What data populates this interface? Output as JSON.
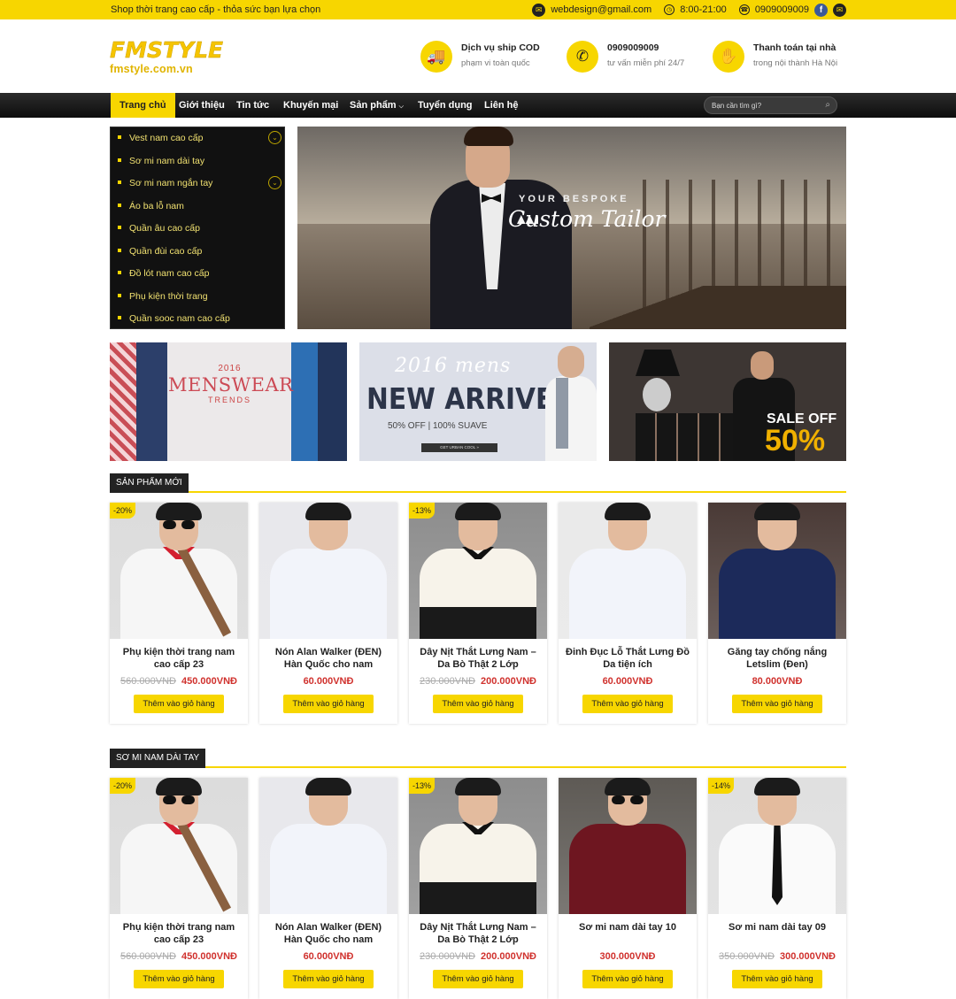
{
  "topbar": {
    "slogan": "Shop thời trang cao cấp - thỏa sức bạn lựa chọn",
    "email": "webdesign@gmail.com",
    "hours": "8:00-21:00",
    "phone": "0909009009"
  },
  "logo": {
    "main": "FMSTYLE",
    "sub": "fmstyle.com.vn"
  },
  "services": [
    {
      "title": "Dịch vụ ship COD",
      "sub": "phạm vi toàn quốc",
      "icon": "truck-icon"
    },
    {
      "title": "0909009009",
      "sub": "tư vấn miễn phí 24/7",
      "icon": "phone-icon"
    },
    {
      "title": "Thanh toán tại nhà",
      "sub": "trong nội thành Hà Nội",
      "icon": "payment-hand-icon"
    }
  ],
  "nav": {
    "items": [
      "Trang chủ",
      "Giới thiệu",
      "Tin tức",
      "Khuyến mại",
      "Sản phẩm",
      "Tuyển dụng",
      "Liên hệ"
    ],
    "active": "Trang chủ",
    "search_placeholder": "Bạn cần tìm gì?"
  },
  "categories": [
    "Vest nam cao cấp",
    "Sơ mi nam dài tay",
    "Sơ mi nam ngắn tay",
    "Áo ba lỗ nam",
    "Quần âu cao cấp",
    "Quần đùi cao cấp",
    "Đồ lót nam cao cấp",
    "Phụ kiện thời trang",
    "Quần sooc nam cao cấp"
  ],
  "hero": {
    "line1": "YOUR BESPOKE",
    "line2": "Custom Tailor"
  },
  "banners": {
    "b1": {
      "year": "2016",
      "main": "MENSWEAR",
      "sub": "TRENDS"
    },
    "b2": {
      "year": "2016 mens",
      "main": "NEW ARRIVE",
      "offer": "50% OFF | 100% SUAVE",
      "button": "GET URBAN COOL »"
    },
    "b3": {
      "sale": "SALE OFF",
      "pct": "50%"
    }
  },
  "sections": [
    {
      "title": "SẢN PHẨM MỚI",
      "products": [
        {
          "name": "Phụ kiện thời trang nam cao cấp 23",
          "old_price": "560.000VNĐ",
          "price": "450.000VNĐ",
          "badge": "-20%",
          "button": "Thêm vào giỏ hàng"
        },
        {
          "name": "Nón Alan Walker (ĐEN) Hàn Quốc cho nam",
          "old_price": "",
          "price": "60.000VNĐ",
          "badge": "",
          "button": "Thêm vào giỏ hàng"
        },
        {
          "name": "Dây Nịt Thắt Lưng Nam – Da Bò Thật 2 Lớp",
          "old_price": "230.000VNĐ",
          "price": "200.000VNĐ",
          "badge": "-13%",
          "button": "Thêm vào giỏ hàng"
        },
        {
          "name": "Đinh Đục Lỗ Thắt Lưng Đồ Da tiện ích",
          "old_price": "",
          "price": "60.000VNĐ",
          "badge": "",
          "button": "Thêm vào giỏ hàng"
        },
        {
          "name": "Găng tay chống nắng Letslim (Đen)",
          "old_price": "",
          "price": "80.000VNĐ",
          "badge": "",
          "button": "Thêm vào giỏ hàng"
        }
      ]
    },
    {
      "title": "SƠ MI NAM DÀI TAY",
      "products": [
        {
          "name": "Phụ kiện thời trang nam cao cấp 23",
          "old_price": "560.000VNĐ",
          "price": "450.000VNĐ",
          "badge": "-20%",
          "button": "Thêm vào giỏ hàng"
        },
        {
          "name": "Nón Alan Walker (ĐEN) Hàn Quốc cho nam",
          "old_price": "",
          "price": "60.000VNĐ",
          "badge": "",
          "button": "Thêm vào giỏ hàng"
        },
        {
          "name": "Dây Nịt Thắt Lưng Nam – Da Bò Thật 2 Lớp",
          "old_price": "230.000VNĐ",
          "price": "200.000VNĐ",
          "badge": "-13%",
          "button": "Thêm vào giỏ hàng"
        },
        {
          "name": "Sơ mi nam dài tay 10",
          "old_price": "",
          "price": "300.000VNĐ",
          "badge": "",
          "button": "Thêm vào giỏ hàng"
        },
        {
          "name": "Sơ mi nam dài tay 09",
          "old_price": "350.000VNĐ",
          "price": "300.000VNĐ",
          "badge": "-14%",
          "button": "Thêm vào giỏ hàng"
        }
      ]
    }
  ],
  "colors": {
    "accent": "#f7d600",
    "dark": "#111111",
    "price": "#d0312d"
  }
}
